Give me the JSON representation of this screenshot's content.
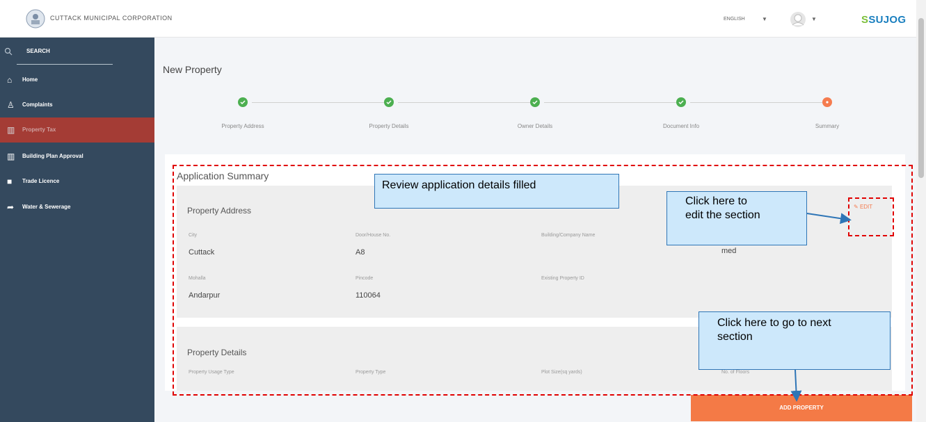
{
  "header": {
    "org_name": "CUTTACK MUNICIPAL CORPORATION",
    "language": "ENGLISH",
    "brand_prefix": "S",
    "brand_rest": "SUJOG"
  },
  "sidebar": {
    "search_label": "SEARCH",
    "items": [
      {
        "label": "Home",
        "icon": "home-icon"
      },
      {
        "label": "Complaints",
        "icon": "user-add-icon"
      },
      {
        "label": "Property Tax",
        "icon": "building-icon"
      },
      {
        "label": "Building Plan Approval",
        "icon": "building-icon"
      },
      {
        "label": "Trade Licence",
        "icon": "briefcase-icon"
      },
      {
        "label": "Water & Sewerage",
        "icon": "share-icon"
      }
    ],
    "active_index": 2
  },
  "main": {
    "title": "New Property",
    "steps": [
      "Property Address",
      "Property Details",
      "Owner Details",
      "Document Info",
      "Summary"
    ],
    "current_step": 5,
    "card_title": "Application Summary",
    "edit_label": "EDIT",
    "address": {
      "title": "Property Address",
      "labels": [
        "City",
        "Door/House No.",
        "Building/Company Name",
        "Mohalla",
        "Pincode",
        "Existing Property ID"
      ],
      "values": [
        "Cuttack",
        "A8",
        "med",
        "Andarpur",
        "110064"
      ]
    },
    "details": {
      "title": "Property Details",
      "labels": [
        "Property Usage Type",
        "Property Type",
        "Plot Size(sq yards)",
        "No. of Floors"
      ]
    },
    "add_button": "ADD PROPERTY"
  },
  "annotations": {
    "review": "Review application details filled",
    "edit_line1": "Click here to",
    "edit_line2": "edit the section",
    "next_line1": "Click here to go to next",
    "next_line2": "section"
  },
  "colors": {
    "sidebar": "#34495e",
    "step_done": "#4caf50",
    "step_current": "#f57c4f",
    "accent": "#f47a46",
    "annotation_border": "#e00000",
    "callout_fill": "#cde8fb"
  }
}
